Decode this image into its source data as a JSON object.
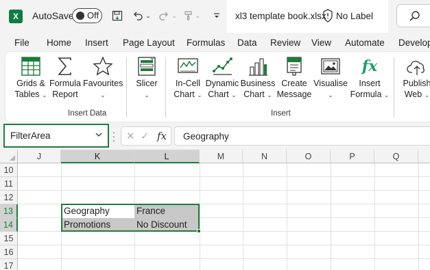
{
  "titlebar": {
    "autosave_label": "AutoSave",
    "autosave_state": "Off",
    "filename": "xl3 template book.xlsx",
    "label_status": "No Label"
  },
  "tabs": [
    "File",
    "Home",
    "Insert",
    "Page Layout",
    "Formulas",
    "Data",
    "Review",
    "View",
    "Automate",
    "Develop"
  ],
  "ribbon": {
    "buttons": [
      {
        "line1": "Grids &",
        "line2": "Tables",
        "icon": "grid-table-icon"
      },
      {
        "line1": "Formula",
        "line2": "Report",
        "icon": "sigma-icon"
      },
      {
        "line1": "Favourites",
        "line2": "",
        "icon": "star-icon"
      },
      {
        "line1": "Slicer",
        "line2": "",
        "icon": "slicer-icon"
      },
      {
        "line1": "In-Cell",
        "line2": "Chart",
        "icon": "sparkline-icon"
      },
      {
        "line1": "Dynamic",
        "line2": "Chart",
        "icon": "line-chart-icon"
      },
      {
        "line1": "Business",
        "line2": "Chart",
        "icon": "bar-chart-icon"
      },
      {
        "line1": "Create",
        "line2": "Message",
        "icon": "message-icon"
      },
      {
        "line1": "Visualise",
        "line2": "",
        "icon": "picture-icon"
      },
      {
        "line1": "Insert",
        "line2": "Formula",
        "icon": "fx-icon"
      },
      {
        "line1": "Publish",
        "line2": "Web",
        "icon": "cloud-upload-icon"
      }
    ],
    "groups": [
      "Insert Data",
      "Insert"
    ]
  },
  "formula_bar": {
    "name_box": "FilterArea",
    "fx": "fx",
    "value": "Geography"
  },
  "grid": {
    "columns": [
      "J",
      "K",
      "L",
      "M",
      "N",
      "O",
      "P",
      "Q"
    ],
    "rows": [
      "10",
      "11",
      "12",
      "13",
      "14",
      "15",
      "16",
      "17"
    ],
    "active_columns": [
      "K",
      "L"
    ],
    "active_rows": [
      "13",
      "14"
    ],
    "cells": {
      "k13": "Geography",
      "l13": "France",
      "k14": "Promotions",
      "l14": "No Discount"
    }
  },
  "colors": {
    "excel_green": "#107c41",
    "selection_green": "#1e7c3a",
    "cell_shade": "#c8c8c8"
  }
}
